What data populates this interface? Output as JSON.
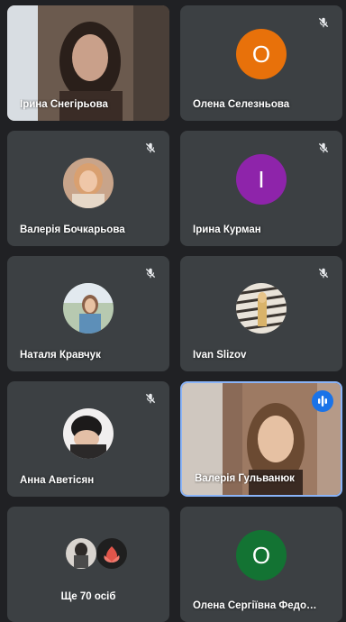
{
  "tiles": [
    {
      "name": "Ірина Снегірьова"
    },
    {
      "name": "Олена Селезньова",
      "initial": "О",
      "color": "#e8710a"
    },
    {
      "name": "Валерія Бочкарьова"
    },
    {
      "name": "Ірина Курман",
      "initial": "І",
      "color": "#8e24aa"
    },
    {
      "name": "Наталя Кравчук"
    },
    {
      "name": "Ivan Slizov"
    },
    {
      "name": "Анна Аветісян"
    },
    {
      "name": "Валерія Гульванюк"
    },
    {
      "name": "Олена Сергіївна Федо…",
      "initial": "О",
      "color": "#137333"
    }
  ],
  "more": {
    "label": "Ще 70 осіб"
  },
  "icons": {
    "muted": "microphone-off-icon",
    "speaking": "audio-level-icon"
  },
  "colors": {
    "background": "#202124",
    "tile": "#3c4043",
    "active_border": "#8ab4f8",
    "speaking_badge": "#1a73e8"
  }
}
